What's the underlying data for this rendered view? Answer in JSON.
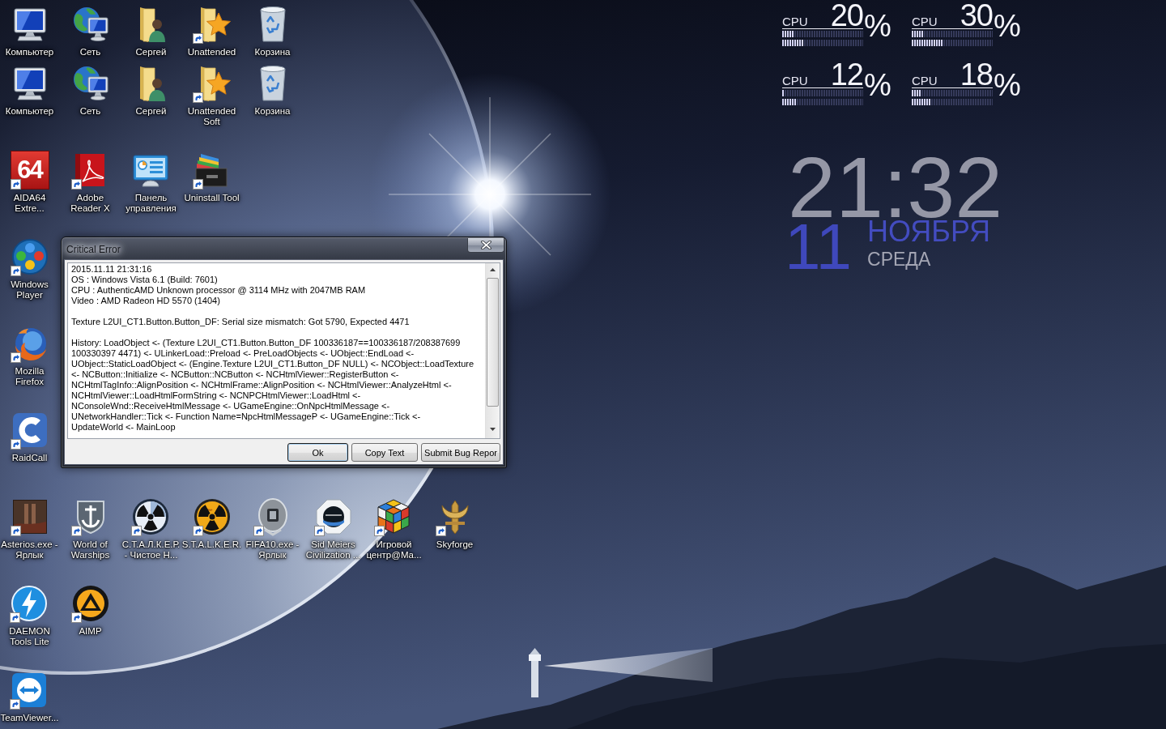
{
  "desktop": {
    "icon_rows": [
      {
        "icons": [
          {
            "kind": "computer",
            "label_lines": [
              "Компьютер"
            ],
            "shortcut": false
          },
          {
            "kind": "network",
            "label_lines": [
              "Сеть"
            ],
            "shortcut": false
          },
          {
            "kind": "userfolder",
            "label_lines": [
              "Сергей"
            ],
            "shortcut": false
          },
          {
            "kind": "starfolder",
            "label_lines": [
              "Unattended"
            ],
            "shortcut": true
          },
          {
            "kind": "recyclebin",
            "label_lines": [
              "Корзина"
            ],
            "shortcut": false
          }
        ]
      },
      {
        "icons": [
          {
            "kind": "computer",
            "label_lines": [
              "Компьютер"
            ],
            "shortcut": false
          },
          {
            "kind": "network",
            "label_lines": [
              "Сеть"
            ],
            "shortcut": false
          },
          {
            "kind": "userfolder",
            "label_lines": [
              "Сергей"
            ],
            "shortcut": false
          },
          {
            "kind": "starfolder",
            "label_lines": [
              "Unattended",
              "Soft"
            ],
            "shortcut": true
          },
          {
            "kind": "recyclebin",
            "label_lines": [
              "Корзина"
            ],
            "shortcut": false
          }
        ]
      },
      {
        "icons": [
          {
            "kind": "numbertile",
            "logo_text": "64",
            "label_lines": [
              "AIDA64",
              "Extre..."
            ],
            "shortcut": true
          },
          {
            "kind": "redbook",
            "label_lines": [
              "Adobe",
              "Reader X"
            ],
            "shortcut": true
          },
          {
            "kind": "controlpanel",
            "label_lines": [
              "Панель",
              "управления"
            ],
            "shortcut": false
          },
          {
            "kind": "cabinet",
            "label_lines": [
              "Uninstall Tool"
            ],
            "shortcut": true
          }
        ]
      },
      {
        "icons": [
          {
            "kind": "dotsdisc",
            "label_lines": [
              "Windows",
              "Player"
            ],
            "shortcut": true
          }
        ]
      },
      {
        "icons": [
          {
            "kind": "foxglobe",
            "label_lines": [
              "Mozilla",
              "Firefox"
            ],
            "shortcut": true
          }
        ]
      },
      {
        "icons": [
          {
            "kind": "arctile",
            "label_lines": [
              "RaidCall"
            ],
            "shortcut": true
          }
        ]
      },
      {
        "icons": [
          {
            "kind": "browntile",
            "label_lines": [
              "Asterios.exe -",
              "Ярлык"
            ],
            "shortcut": true
          },
          {
            "kind": "anchorshield",
            "label_lines": [
              "World of",
              "Warships"
            ],
            "shortcut": true
          },
          {
            "kind": "radiationwhite",
            "label_lines": [
              "С.Т.А.Л.К.Е.Р.",
              "- Чистое Н..."
            ],
            "shortcut": true
          },
          {
            "kind": "radiationyellow",
            "label_lines": [
              "S.T.A.L.K.E.R."
            ],
            "shortcut": true
          },
          {
            "kind": "silverbadge",
            "label_lines": [
              "FIFA10.exe -",
              "Ярлык"
            ],
            "shortcut": true
          },
          {
            "kind": "ringemblem",
            "label_lines": [
              "Sid Meiers",
              "Civilization ..."
            ],
            "shortcut": true
          },
          {
            "kind": "cube",
            "label_lines": [
              "Игровой",
              "центр@Ма..."
            ],
            "shortcut": true
          },
          {
            "kind": "goldemblem",
            "label_lines": [
              "Skyforge"
            ],
            "shortcut": true
          }
        ]
      },
      {
        "icons": [
          {
            "kind": "lightning",
            "label_lines": [
              "DAEMON",
              "Tools Lite"
            ],
            "shortcut": true
          },
          {
            "kind": "triangledisc",
            "label_lines": [
              "AIMP"
            ],
            "shortcut": true
          }
        ]
      },
      {
        "icons": [
          {
            "kind": "arrowtile",
            "label_lines": [
              "TeamViewer..."
            ],
            "shortcut": true
          }
        ]
      }
    ]
  },
  "gadgets": {
    "cpu_meters": [
      {
        "label": "CPU",
        "value": "20",
        "unit": "%",
        "cores": [
          {
            "level": 0.15
          },
          {
            "level": 0.28
          }
        ]
      },
      {
        "label": "CPU",
        "value": "30",
        "unit": "%",
        "cores": [
          {
            "level": 0.15
          },
          {
            "level": 0.4
          }
        ]
      },
      {
        "label": "CPU",
        "value": "12",
        "unit": "%",
        "cores": [
          {
            "level": 0.04
          },
          {
            "level": 0.19
          }
        ]
      },
      {
        "label": "CPU",
        "value": "18",
        "unit": "%",
        "cores": [
          {
            "level": 0.11
          },
          {
            "level": 0.23
          }
        ]
      }
    ],
    "clock": {
      "time": "21:32",
      "day": "11",
      "month": "НОЯБРЯ",
      "weekday": "СРЕДА"
    }
  },
  "dialog": {
    "title": "Critical Error",
    "log_sections": [
      {
        "lines": [
          "2015.11.11 21:31:16",
          "OS : Windows Vista 6.1 (Build: 7601)",
          "CPU : AuthenticAMD Unknown processor @ 3114 MHz with 2047MB RAM",
          "Video : AMD Radeon HD 5570 (1404)"
        ]
      },
      {
        "lines": [
          "Texture L2UI_CT1.Button.Button_DF: Serial size mismatch: Got 5790, Expected 4471"
        ]
      },
      {
        "lines": [
          "History: LoadObject <- (Texture L2UI_CT1.Button.Button_DF 100336187==100336187/208387699",
          "100330397 4471) <- ULinkerLoad::Preload <- PreLoadObjects <- UObject::EndLoad <-",
          "UObject::StaticLoadObject <- (Engine.Texture L2UI_CT1.Button_DF NULL) <- NCObject::LoadTexture",
          "<- NCButton::Initialize <- NCButton::NCButton <- NCHtmlViewer::RegisterButton <-",
          "NCHtmlTagInfo::AlignPosition <- NCHtmlFrame::AlignPosition <- NCHtmlViewer::AnalyzeHtml <-",
          "NCHtmlViewer::LoadHtmlFormString <- NCNPCHtmlViewer::LoadHtml <-",
          "NConsoleWnd::ReceiveHtmlMessage <- UGameEngine::OnNpcHtmlMessage <-",
          "UNetworkHandler::Tick <- Function Name=NpcHtmlMessageP <- UGameEngine::Tick <-",
          "UpdateWorld <- MainLoop"
        ]
      }
    ],
    "buttons": [
      {
        "label": "Ok",
        "default": true
      },
      {
        "label": "Copy Text",
        "default": false
      },
      {
        "label": "Submit Bug Repor",
        "default": false
      }
    ]
  }
}
